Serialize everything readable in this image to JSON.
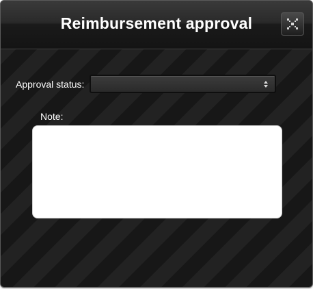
{
  "dialog": {
    "title": "Reimbursement approval",
    "close_icon": "close-icon"
  },
  "form": {
    "status_label": "Approval status:",
    "status_value": "",
    "note_label": "Note:",
    "note_value": ""
  },
  "colors": {
    "dialog_background": "#1b1b1b",
    "stripe_light": "#222222",
    "stripe_dark": "#171717",
    "title_text": "#ffffff",
    "textarea_background": "#ffffff"
  }
}
